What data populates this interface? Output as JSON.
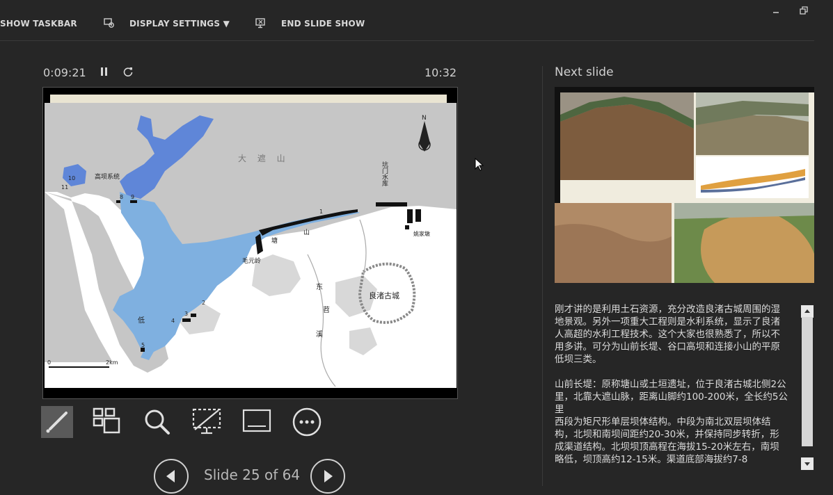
{
  "toolbar": {
    "show_taskbar": "SHOW TASKBAR",
    "display_settings": "DISPLAY SETTINGS ▼",
    "end_slide_show": "END SLIDE SHOW"
  },
  "timer": {
    "elapsed": "0:09:21",
    "clock": "10:32"
  },
  "nav": {
    "counter": "Slide 25 of 64"
  },
  "next_slide": {
    "title": "Next slide"
  },
  "map": {
    "labels": {
      "mountain": "大 遮 山",
      "dam_system": "高坝系统",
      "reservoir": "坑门水库",
      "yaojiadun": "姚家墩",
      "tangshan_1": "塘",
      "tangshan_2": "山",
      "maoyuanling": "毛元岭",
      "liangzhu": "良渚古城",
      "dong": "东",
      "tiao": "苕",
      "xi": "溪",
      "di": "低",
      "scale_0": "0",
      "scale_2km": "2km",
      "north": "N",
      "n1": "1",
      "n2": "2",
      "n3": "3",
      "n4": "4",
      "n5": "5",
      "n8": "8",
      "n9": "9",
      "n10": "10",
      "n11": "11"
    }
  },
  "notes": {
    "p1": "刚才讲的是利用土石资源，充分改造良渚古城周围的湿地景观。另外一项重大工程则是水利系统，显示了良渚人高超的水利工程技术。这个大家也很熟悉了，所以不用多讲。可分为山前长堤、谷口高坝和连接小山的平原低坝三类。",
    "p2": "山前长堤：原称塘山或土垣遗址，位于良渚古城北侧2公里，北靠大遮山脉，距离山脚约100-200米，全长约5公里",
    "p3": "西段为矩尺形单层坝体结构。中段为南北双层坝体结构，北坝和南坝间距约20-30米，并保持同步转折，形成渠道结构。北坝坝顶高程在海拔15-20米左右，南坝略低，坝顶高约12-15米。渠道底部海拔约7-8"
  },
  "colors": {
    "background": "#262626",
    "water_light": "#7fb0e0",
    "water_dark": "#5f86d8",
    "land_grey": "#c6c6c6",
    "text": "#d0d0d0"
  }
}
